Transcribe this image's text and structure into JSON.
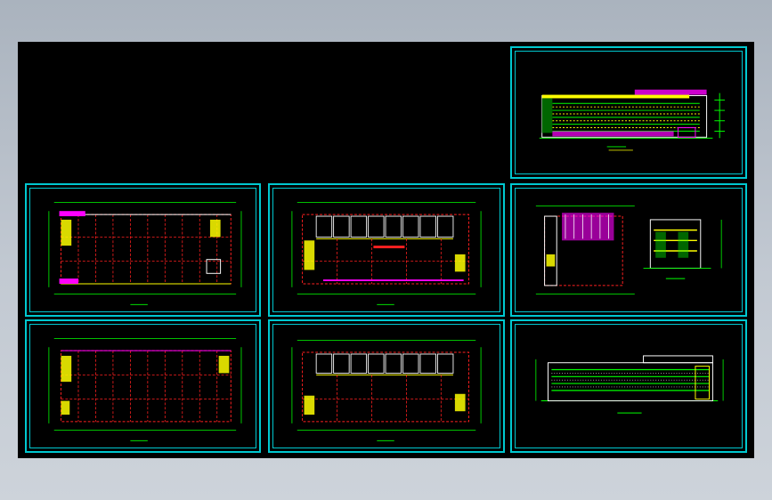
{
  "window": {
    "title": "",
    "background_color": "#b6bec8",
    "canvas_color": "#000000",
    "frame_color": "#00c8d0"
  },
  "drawing": {
    "sheets": [
      {
        "id": "elevation-1",
        "kind": "elevation"
      },
      {
        "id": "plan-1",
        "kind": "floor-plan"
      },
      {
        "id": "plan-2",
        "kind": "floor-plan-rooms"
      },
      {
        "id": "plan-3",
        "kind": "floor-plan-partial"
      },
      {
        "id": "plan-4",
        "kind": "floor-plan"
      },
      {
        "id": "plan-5",
        "kind": "floor-plan-rooms"
      },
      {
        "id": "elevation-2",
        "kind": "elevation"
      }
    ],
    "colors": {
      "axis": "#00ff00",
      "grid": "#ff2020",
      "wall": "#ffffff",
      "core": "#ffff00",
      "accent": "#ff00ff"
    }
  }
}
